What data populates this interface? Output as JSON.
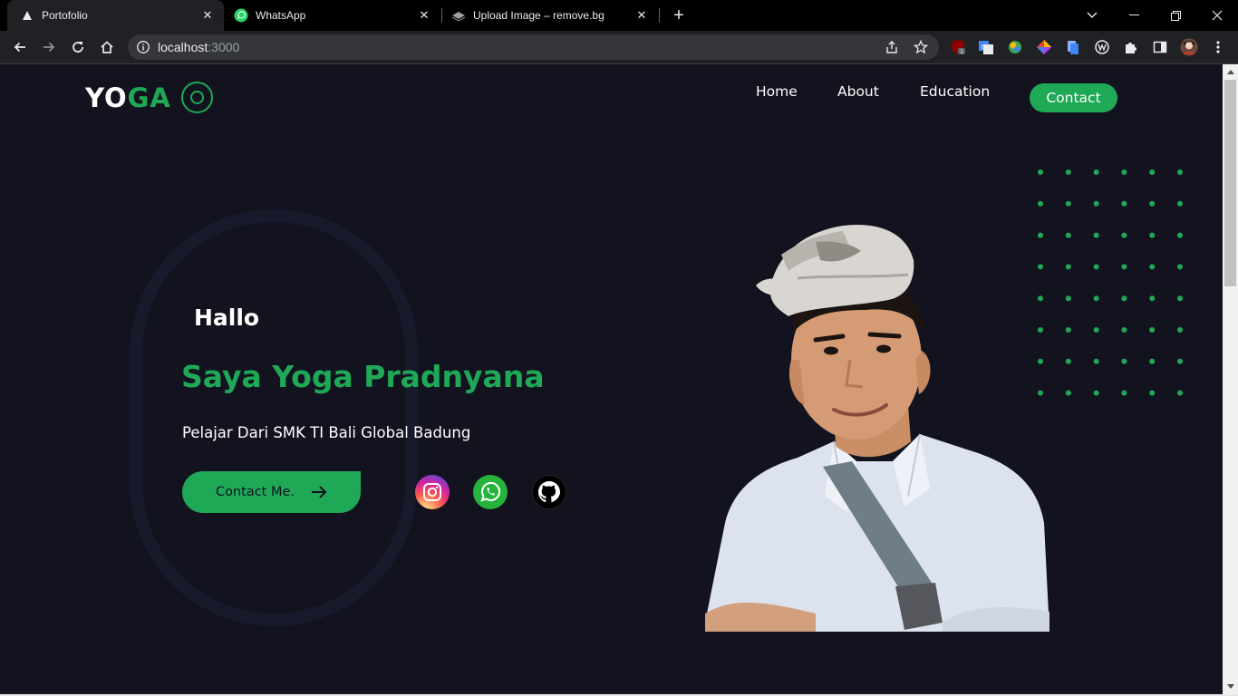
{
  "browser": {
    "tabs": [
      {
        "title": "Portofolio",
        "icon": "portfolio-favicon",
        "active": true
      },
      {
        "title": "WhatsApp",
        "icon": "whatsapp-favicon",
        "active": false
      },
      {
        "title": "Upload Image – remove.bg",
        "icon": "removebg-favicon",
        "active": false
      }
    ],
    "url_host": "localhost",
    "url_port": ":3000",
    "extension_badge": "1"
  },
  "site": {
    "logo_prefix": "YO",
    "logo_suffix": "GA",
    "nav": {
      "home": "Home",
      "about": "About",
      "education": "Education",
      "contact": "Contact"
    },
    "hero": {
      "greeting": "Hallo",
      "name": "Saya Yoga Pradnyana",
      "subtitle": "Pelajar Dari SMK TI Bali Global Badung",
      "cta_label": "Contact Me."
    },
    "social": [
      "instagram-icon",
      "whatsapp-icon",
      "github-icon"
    ],
    "colors": {
      "accent": "#1fa957",
      "background": "#13131f",
      "text": "#ffffff"
    }
  }
}
